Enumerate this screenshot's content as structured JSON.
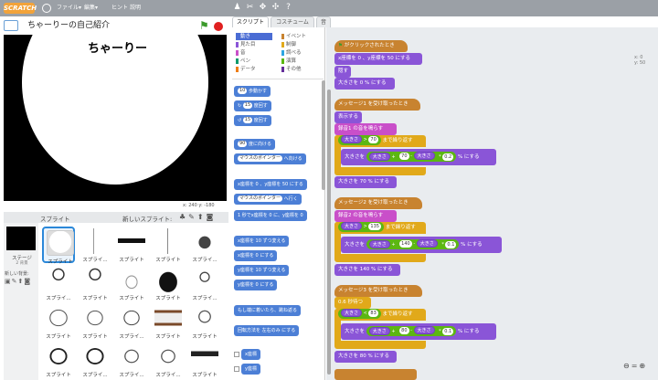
{
  "topbar": {
    "logo": "SCRATCH",
    "file": "ファイル▾",
    "edit": "編集▾",
    "tips": "ヒント",
    "about": "説明"
  },
  "project": {
    "title": "ちゃーりーの自己紹介",
    "stage_text": "ちゃーりー",
    "coords": "x: 240  y: -180"
  },
  "sprites_panel": {
    "label": "スプライト",
    "new_sprite": "新しいスプライト:",
    "stage_label": "ステージ",
    "stage_sub": "2 背景",
    "new_backdrop": "新しい背景:"
  },
  "sprite_names": [
    "スプライト",
    "スプライ...",
    "スプライト",
    "スプライト",
    "スプライ...",
    "スプライ...",
    "スプライト",
    "スプライト",
    "スプライト",
    "スプライ...",
    "スプライト",
    "スプライト",
    "スプライ...",
    "スプライト",
    "スプライト",
    "スプライト",
    "スプライ...",
    "スプライ...",
    "スプライ...",
    "スプライト"
  ],
  "tabs": [
    "スクリプト",
    "コスチューム",
    "音"
  ],
  "categories": [
    {
      "label": "動き",
      "color": "#4a6cd4"
    },
    {
      "label": "見た目",
      "color": "#8a55d7"
    },
    {
      "label": "音",
      "color": "#c94fc9"
    },
    {
      "label": "ペン",
      "color": "#0e9a6c"
    },
    {
      "label": "データ",
      "color": "#ee7d16"
    },
    {
      "label": "イベント",
      "color": "#c88330"
    },
    {
      "label": "制御",
      "color": "#e1a91a"
    },
    {
      "label": "調べる",
      "color": "#2ca5e2"
    },
    {
      "label": "演算",
      "color": "#5cb712"
    },
    {
      "label": "その他",
      "color": "#632d99"
    }
  ],
  "palette": {
    "move": "歩動かす",
    "move_v": "10",
    "turn_r": "度回す",
    "turn_r_v": "15",
    "turn_l": "度回す",
    "turn_l_v": "15",
    "point_dir": "度に向ける",
    "point_dir_v": "90",
    "point_towards": "マウスのポインター",
    "point_towards_s": "へ向ける",
    "goto_xy": "x座標を 0 、y座標を 50 にする",
    "goto": "マウスのポインター",
    "goto_s": "へ行く",
    "glide": "1 秒でx座標を 0 に、y座標を 0",
    "change_x": "x座標を 10 ずつ変える",
    "set_x": "x座標を 0 にする",
    "change_y": "y座標を 10 ずつ変える",
    "set_y": "y座標を 0 にする",
    "bounce": "もし端に着いたら、跳ね返る",
    "rot_style": "回転方法を 左右のみ にする",
    "rep_x": "x座標",
    "rep_y": "y座標"
  },
  "script": {
    "sprite_info": "x: 0\ny: 50",
    "h1": "がクリックされたとき",
    "b1": "x座標を 0 、y座標を 50 にする",
    "b2": "隠す",
    "b3": "大きさを 0 % にする",
    "h2": "メッセージ1 を受け取ったとき",
    "b4": "表示する",
    "b5": "録音1 の音を鳴らす",
    "r1": "まで繰り返す",
    "r1_a": "大きさ",
    "r1_op": ">",
    "r1_b": "70",
    "s1": "大きさを",
    "s1_a": "大きさ",
    "s1_p": "+",
    "s1_b": "70",
    "s1_m": "-",
    "s1_c": "大きさ",
    "s1_x": "*",
    "s1_d": "0.2",
    "s1_e": "% にする",
    "b6": "大きさを 70 % にする",
    "h3": "メッセージ2 を受け取ったとき",
    "b7": "録音2 の音を鳴らす",
    "r2": "まで繰り返す",
    "r2_a": "大きさ",
    "r2_op": ">",
    "r2_b": "135",
    "s2": "大きさを",
    "s2_a": "大きさ",
    "s2_p": "+",
    "s2_b": "140",
    "s2_m": "-",
    "s2_c": "大きさ",
    "s2_x": "*",
    "s2_d": "0.1",
    "s2_e": "% にする",
    "b8": "大きさを 140 % にする",
    "h4": "メッセージ3 を受け取ったとき",
    "b9": "0.6 秒待つ",
    "r3": "まで繰り返す",
    "r3_a": "大きさ",
    "r3_op": "<",
    "r3_b": "83",
    "s3": "大きさを",
    "s3_a": "大きさ",
    "s3_p": "+",
    "s3_b": "80",
    "s3_m": "-",
    "s3_c": "大きさ",
    "s3_x": "*",
    "s3_d": "0.1",
    "s3_e": "% にする",
    "b10": "大きさを 80 % にする"
  }
}
